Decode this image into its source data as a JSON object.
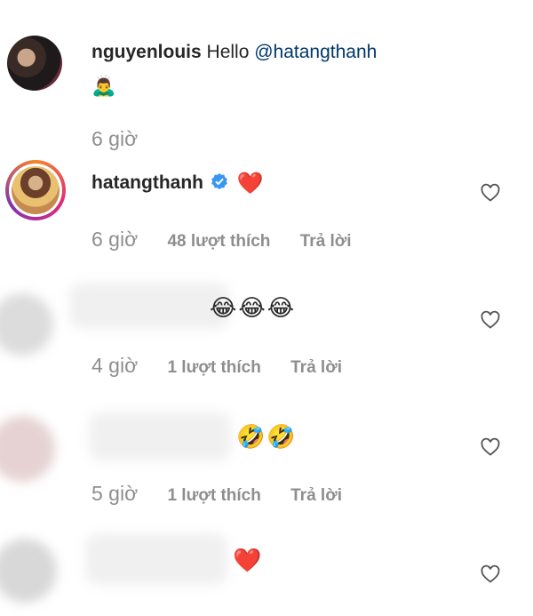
{
  "comments": [
    {
      "username": "nguyenlouis",
      "text": "Hello",
      "mention": "@hatangthanh",
      "emoji_line": "🙇‍♂️",
      "time": "6 giờ"
    },
    {
      "username": "hatangthanh",
      "verified": true,
      "emoji": "❤️",
      "time": "6 giờ",
      "likes": "48 lượt thích",
      "reply": "Trả lời"
    },
    {
      "emoji": "😂😂😂",
      "time": "4 giờ",
      "likes": "1 lượt thích",
      "reply": "Trả lời"
    },
    {
      "emoji": "🤣🤣",
      "time": "5 giờ",
      "likes": "1 lượt thích",
      "reply": "Trả lời"
    },
    {
      "emoji": "❤️"
    }
  ],
  "colors": {
    "mention": "#00376b",
    "meta": "#8e8e8e",
    "verified": "#3897f0",
    "heart": "#ed4956"
  },
  "icons": [
    "like-heart-outline-icon",
    "verified-badge-icon"
  ]
}
